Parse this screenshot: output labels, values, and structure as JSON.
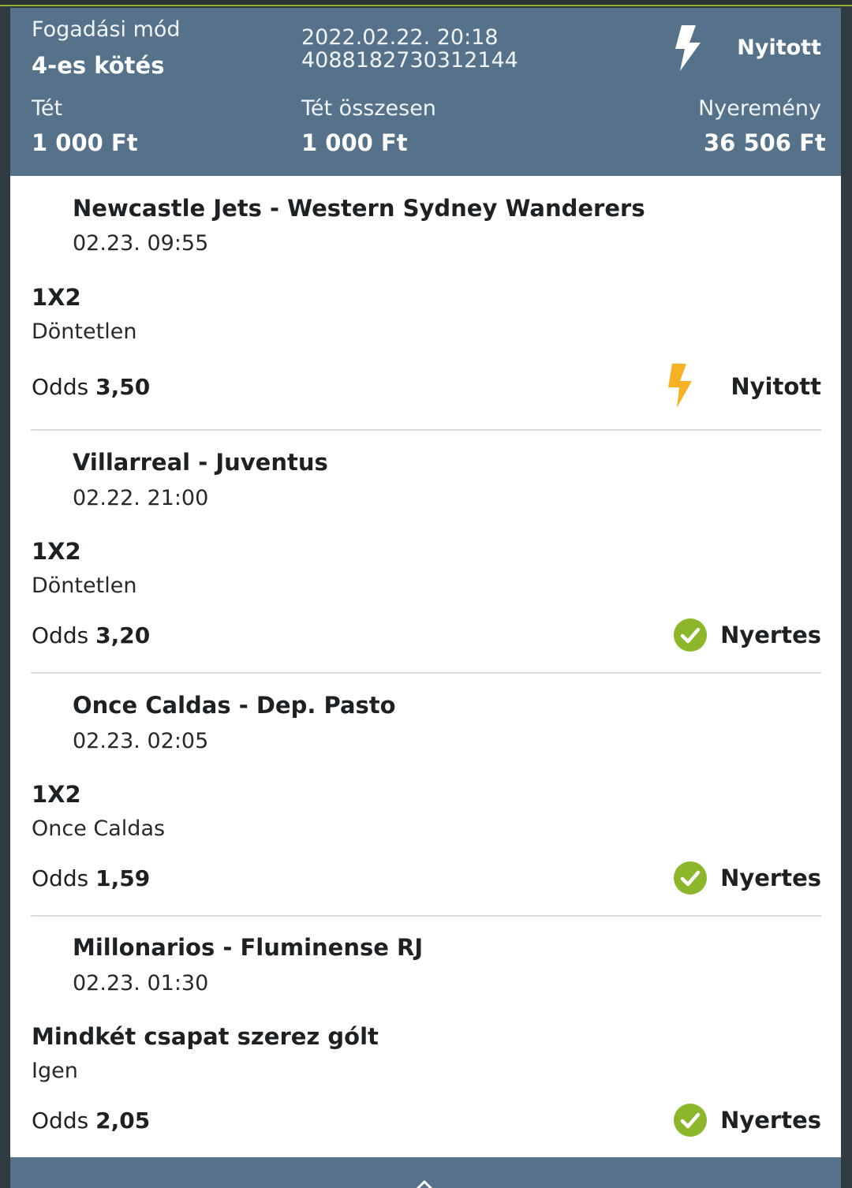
{
  "header": {
    "mode_label": "Fogadási mód",
    "mode_value": "4-es kötés",
    "datetime": "2022.02.22. 20:18",
    "ticket_id": "4088182730312144",
    "status": "Nyitott",
    "stake_label": "Tét",
    "stake_value": "1 000 Ft",
    "total_stake_label": "Tét összesen",
    "total_stake_value": "1 000 Ft",
    "winnings_label": "Nyeremény",
    "winnings_value": "36 506 Ft"
  },
  "odds_label": "Odds",
  "matches": [
    {
      "title": "Newcastle Jets - Western Sydney Wanderers",
      "time": "02.23. 09:55",
      "market": "1X2",
      "selection": "Döntetlen",
      "odds": "3,50",
      "status": "Nyitott",
      "status_icon": "lightning-icon"
    },
    {
      "title": "Villarreal - Juventus",
      "time": "02.22. 21:00",
      "market": "1X2",
      "selection": "Döntetlen",
      "odds": "3,20",
      "status": "Nyertes",
      "status_icon": "check-circle-icon"
    },
    {
      "title": "Once Caldas - Dep. Pasto",
      "time": "02.23. 02:05",
      "market": "1X2",
      "selection": "Once Caldas",
      "odds": "1,59",
      "status": "Nyertes",
      "status_icon": "check-circle-icon"
    },
    {
      "title": "Millonarios - Fluminense RJ",
      "time": "02.23. 01:30",
      "market": "Mindkét csapat szerez gólt",
      "selection": "Igen",
      "odds": "2,05",
      "status": "Nyertes",
      "status_icon": "check-circle-icon"
    }
  ],
  "colors": {
    "header_bg": "#56728a",
    "open_bolt": "#f5b324",
    "win_green": "#8cb72a",
    "page_bg": "#2f3a41"
  }
}
